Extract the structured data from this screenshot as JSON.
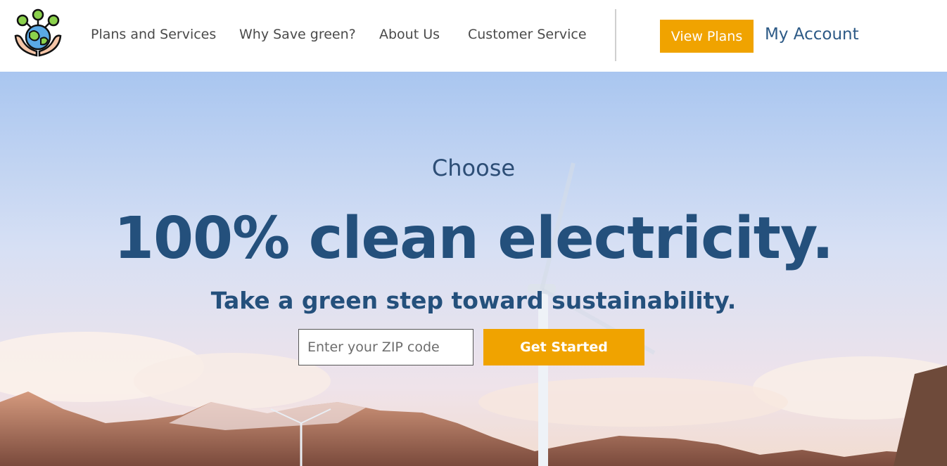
{
  "brand": {
    "logo_icon": "earth-in-hands-icon"
  },
  "nav": {
    "items": [
      {
        "label": "Plans and Services"
      },
      {
        "label": "Why Save green?"
      },
      {
        "label": "About Us"
      },
      {
        "label": "Customer Service"
      }
    ],
    "view_plans_label": "View Plans",
    "account_label": "My Account"
  },
  "hero": {
    "eyebrow": "Choose",
    "headline": "100% clean electricity.",
    "subhead": "Take a green step toward sustainability.",
    "zip_placeholder": "Enter your ZIP code",
    "cta_label": "Get Started",
    "background_icon": "wind-turbine-mountains-image"
  },
  "colors": {
    "accent": "#f0a300",
    "text_primary": "#24507c",
    "nav_text": "#4a4a4a"
  }
}
